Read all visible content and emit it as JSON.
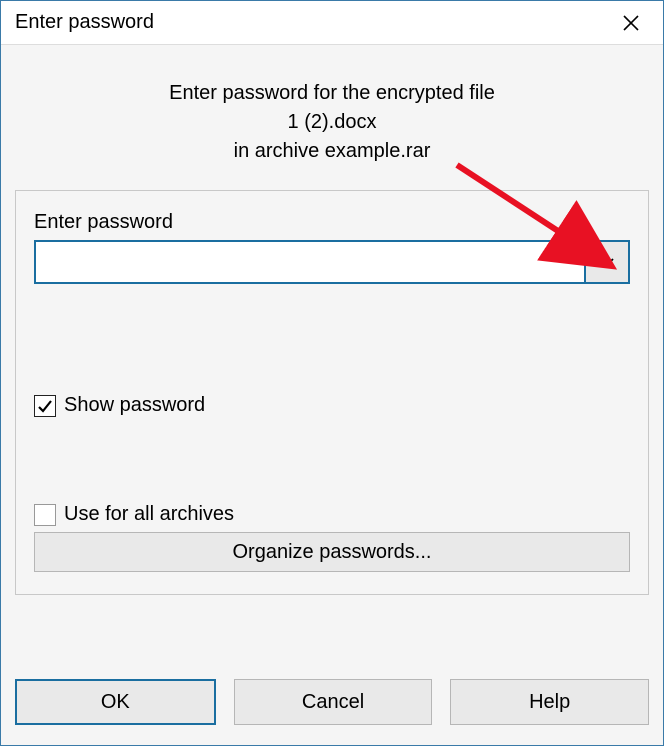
{
  "titlebar": {
    "title": "Enter password"
  },
  "prompt": {
    "line1": "Enter password for the encrypted file",
    "line2": "1 (2).docx",
    "line3": "in archive example.rar"
  },
  "field": {
    "label": "Enter password",
    "value": ""
  },
  "checkboxes": {
    "show_password_label": "Show password",
    "show_password_checked": true,
    "use_all_label": "Use for all archives",
    "use_all_checked": false
  },
  "buttons": {
    "organize": "Organize passwords...",
    "ok": "OK",
    "cancel": "Cancel",
    "help": "Help"
  }
}
